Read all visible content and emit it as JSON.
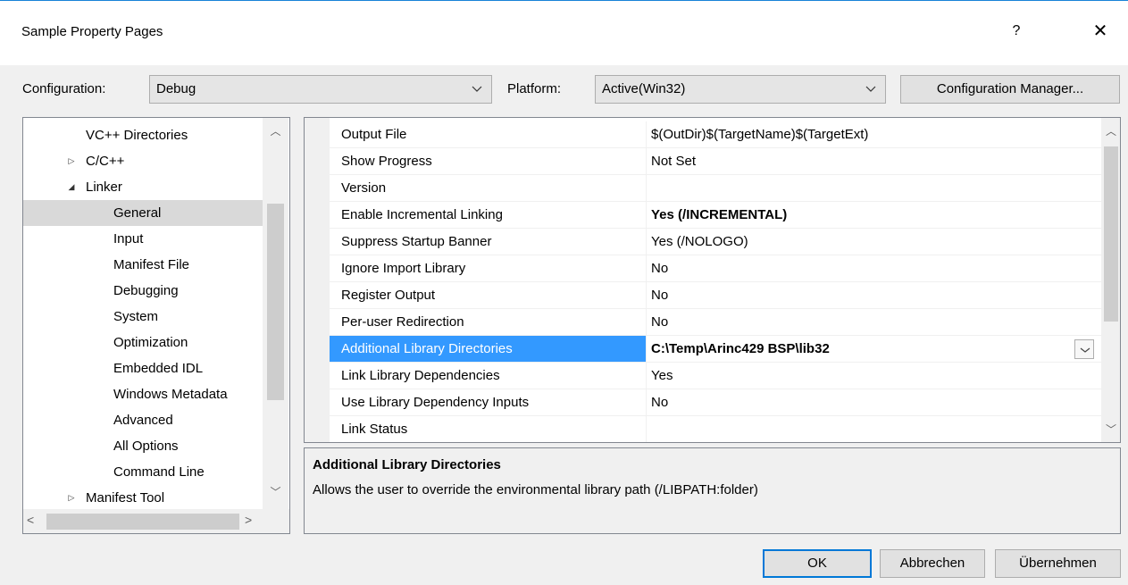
{
  "window": {
    "title": "Sample Property Pages",
    "help_label": "?",
    "close_label": "✕"
  },
  "toolbar": {
    "configuration_label": "Configuration:",
    "configuration_value": "Debug",
    "platform_label": "Platform:",
    "platform_value": "Active(Win32)",
    "config_manager_label": "Configuration Manager..."
  },
  "tree": {
    "items": [
      {
        "label": "VC++ Directories"
      },
      {
        "label": "C/C++"
      },
      {
        "label": "Linker"
      },
      {
        "label": "General"
      },
      {
        "label": "Input"
      },
      {
        "label": "Manifest File"
      },
      {
        "label": "Debugging"
      },
      {
        "label": "System"
      },
      {
        "label": "Optimization"
      },
      {
        "label": "Embedded IDL"
      },
      {
        "label": "Windows Metadata"
      },
      {
        "label": "Advanced"
      },
      {
        "label": "All Options"
      },
      {
        "label": "Command Line"
      },
      {
        "label": "Manifest Tool"
      }
    ],
    "selected": "General"
  },
  "grid": {
    "rows": [
      {
        "name": "Output File",
        "value": "$(OutDir)$(TargetName)$(TargetExt)"
      },
      {
        "name": "Show Progress",
        "value": "Not Set"
      },
      {
        "name": "Version",
        "value": ""
      },
      {
        "name": "Enable Incremental Linking",
        "value": "Yes (/INCREMENTAL)"
      },
      {
        "name": "Suppress Startup Banner",
        "value": "Yes (/NOLOGO)"
      },
      {
        "name": "Ignore Import Library",
        "value": "No"
      },
      {
        "name": "Register Output",
        "value": "No"
      },
      {
        "name": "Per-user Redirection",
        "value": "No"
      },
      {
        "name": "Additional Library Directories",
        "value": "C:\\Temp\\Arinc429 BSP\\lib32"
      },
      {
        "name": "Link Library Dependencies",
        "value": "Yes"
      },
      {
        "name": "Use Library Dependency Inputs",
        "value": "No"
      },
      {
        "name": "Link Status",
        "value": ""
      }
    ],
    "selected": "Additional Library Directories"
  },
  "description": {
    "title": "Additional Library Directories",
    "text": "Allows the user to override the environmental library path (/LIBPATH:folder)"
  },
  "buttons": {
    "ok": "OK",
    "cancel": "Abbrechen",
    "apply": "Übernehmen"
  },
  "colors": {
    "selection": "#3399ff",
    "tree_selection": "#d9d9d9",
    "default_button_border": "#0078d7"
  }
}
